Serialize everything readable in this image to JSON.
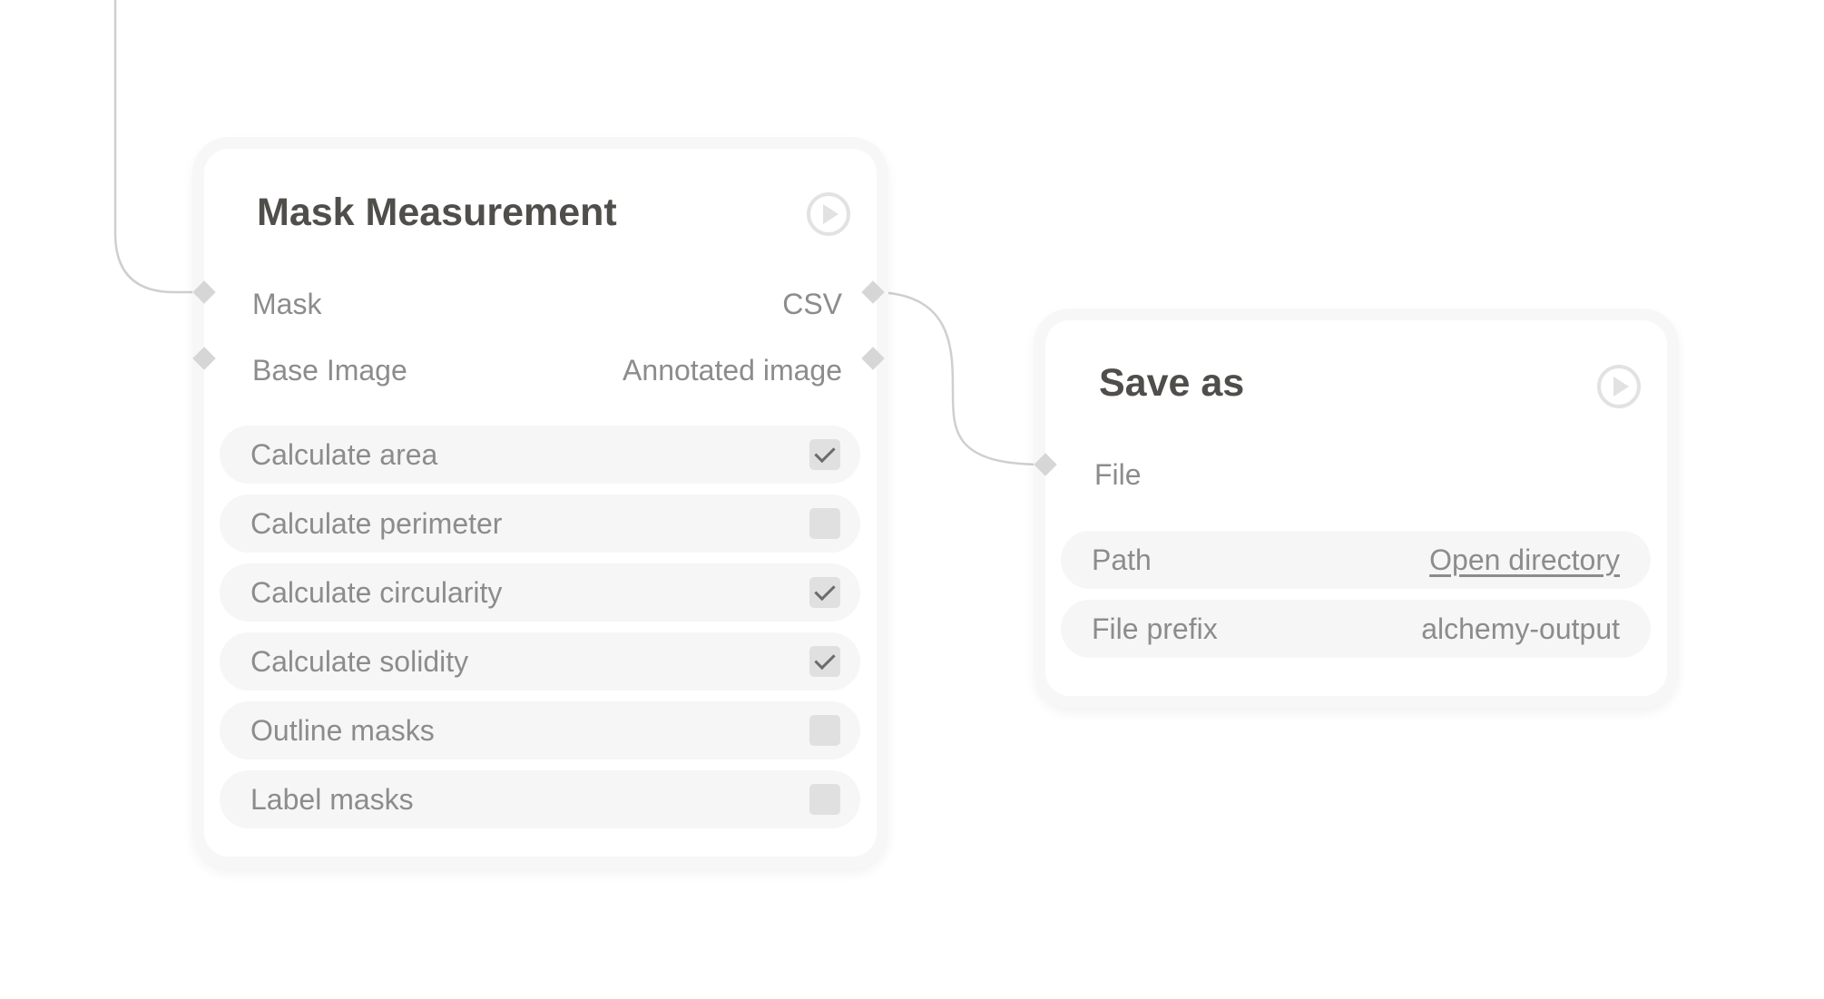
{
  "colors": {
    "wire": "#cfcfcf",
    "node_border": "#f7f7f7",
    "row_bg": "#f6f6f6",
    "title_text": "#4f4e4a",
    "label_text": "#8c8c8c",
    "port": "#d6d6d6",
    "checkbox_bg": "#e0e0e0",
    "checkmark": "#6b6b6b"
  },
  "mask_node": {
    "title": "Mask Measurement",
    "run_icon": "play-circle-icon",
    "inputs": [
      "Mask",
      "Base Image"
    ],
    "outputs": [
      "CSV",
      "Annotated image"
    ],
    "options": [
      {
        "label": "Calculate area",
        "checked": true
      },
      {
        "label": "Calculate perimeter",
        "checked": false
      },
      {
        "label": "Calculate circularity",
        "checked": true
      },
      {
        "label": "Calculate solidity",
        "checked": true
      },
      {
        "label": "Outline masks",
        "checked": false
      },
      {
        "label": "Label masks",
        "checked": false
      }
    ]
  },
  "save_node": {
    "title": "Save as",
    "run_icon": "play-circle-icon",
    "inputs": [
      "File"
    ],
    "fields": [
      {
        "label": "Path",
        "value": "Open directory"
      },
      {
        "label": "File prefix",
        "value": "alchemy-output"
      }
    ]
  }
}
